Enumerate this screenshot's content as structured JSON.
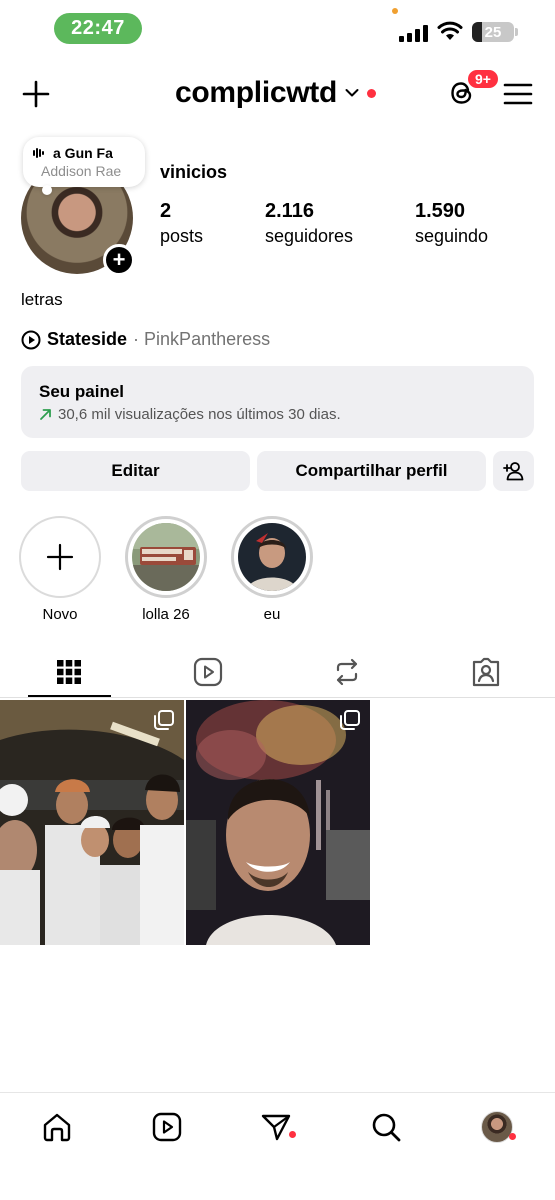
{
  "status_bar": {
    "time": "22:47",
    "battery": "25"
  },
  "header": {
    "username": "complicwtd",
    "notifications_badge": "9+"
  },
  "profile": {
    "display_name": "vinicios",
    "music_note": {
      "song": "a Gun   Fa",
      "artist": "Addison Rae"
    },
    "stats": [
      {
        "value": "2",
        "label": "posts"
      },
      {
        "value": "2.116",
        "label": "seguidores"
      },
      {
        "value": "1.590",
        "label": "seguindo"
      }
    ],
    "bio": "letras",
    "song": {
      "title": "Stateside",
      "artist": "· PinkPantheress"
    }
  },
  "dashboard": {
    "title": "Seu painel",
    "subtitle": "30,6 mil visualizações nos últimos 30 dias."
  },
  "buttons": {
    "edit": "Editar",
    "share": "Compartilhar perfil"
  },
  "highlights": [
    {
      "label": "Novo"
    },
    {
      "label": "lolla 26"
    },
    {
      "label": "eu"
    }
  ],
  "colors": {
    "accent_red": "#ff3040",
    "time_pill": "#5cb85c",
    "panel_bg": "#efeff2",
    "trend_green": "#2e9e4f"
  }
}
